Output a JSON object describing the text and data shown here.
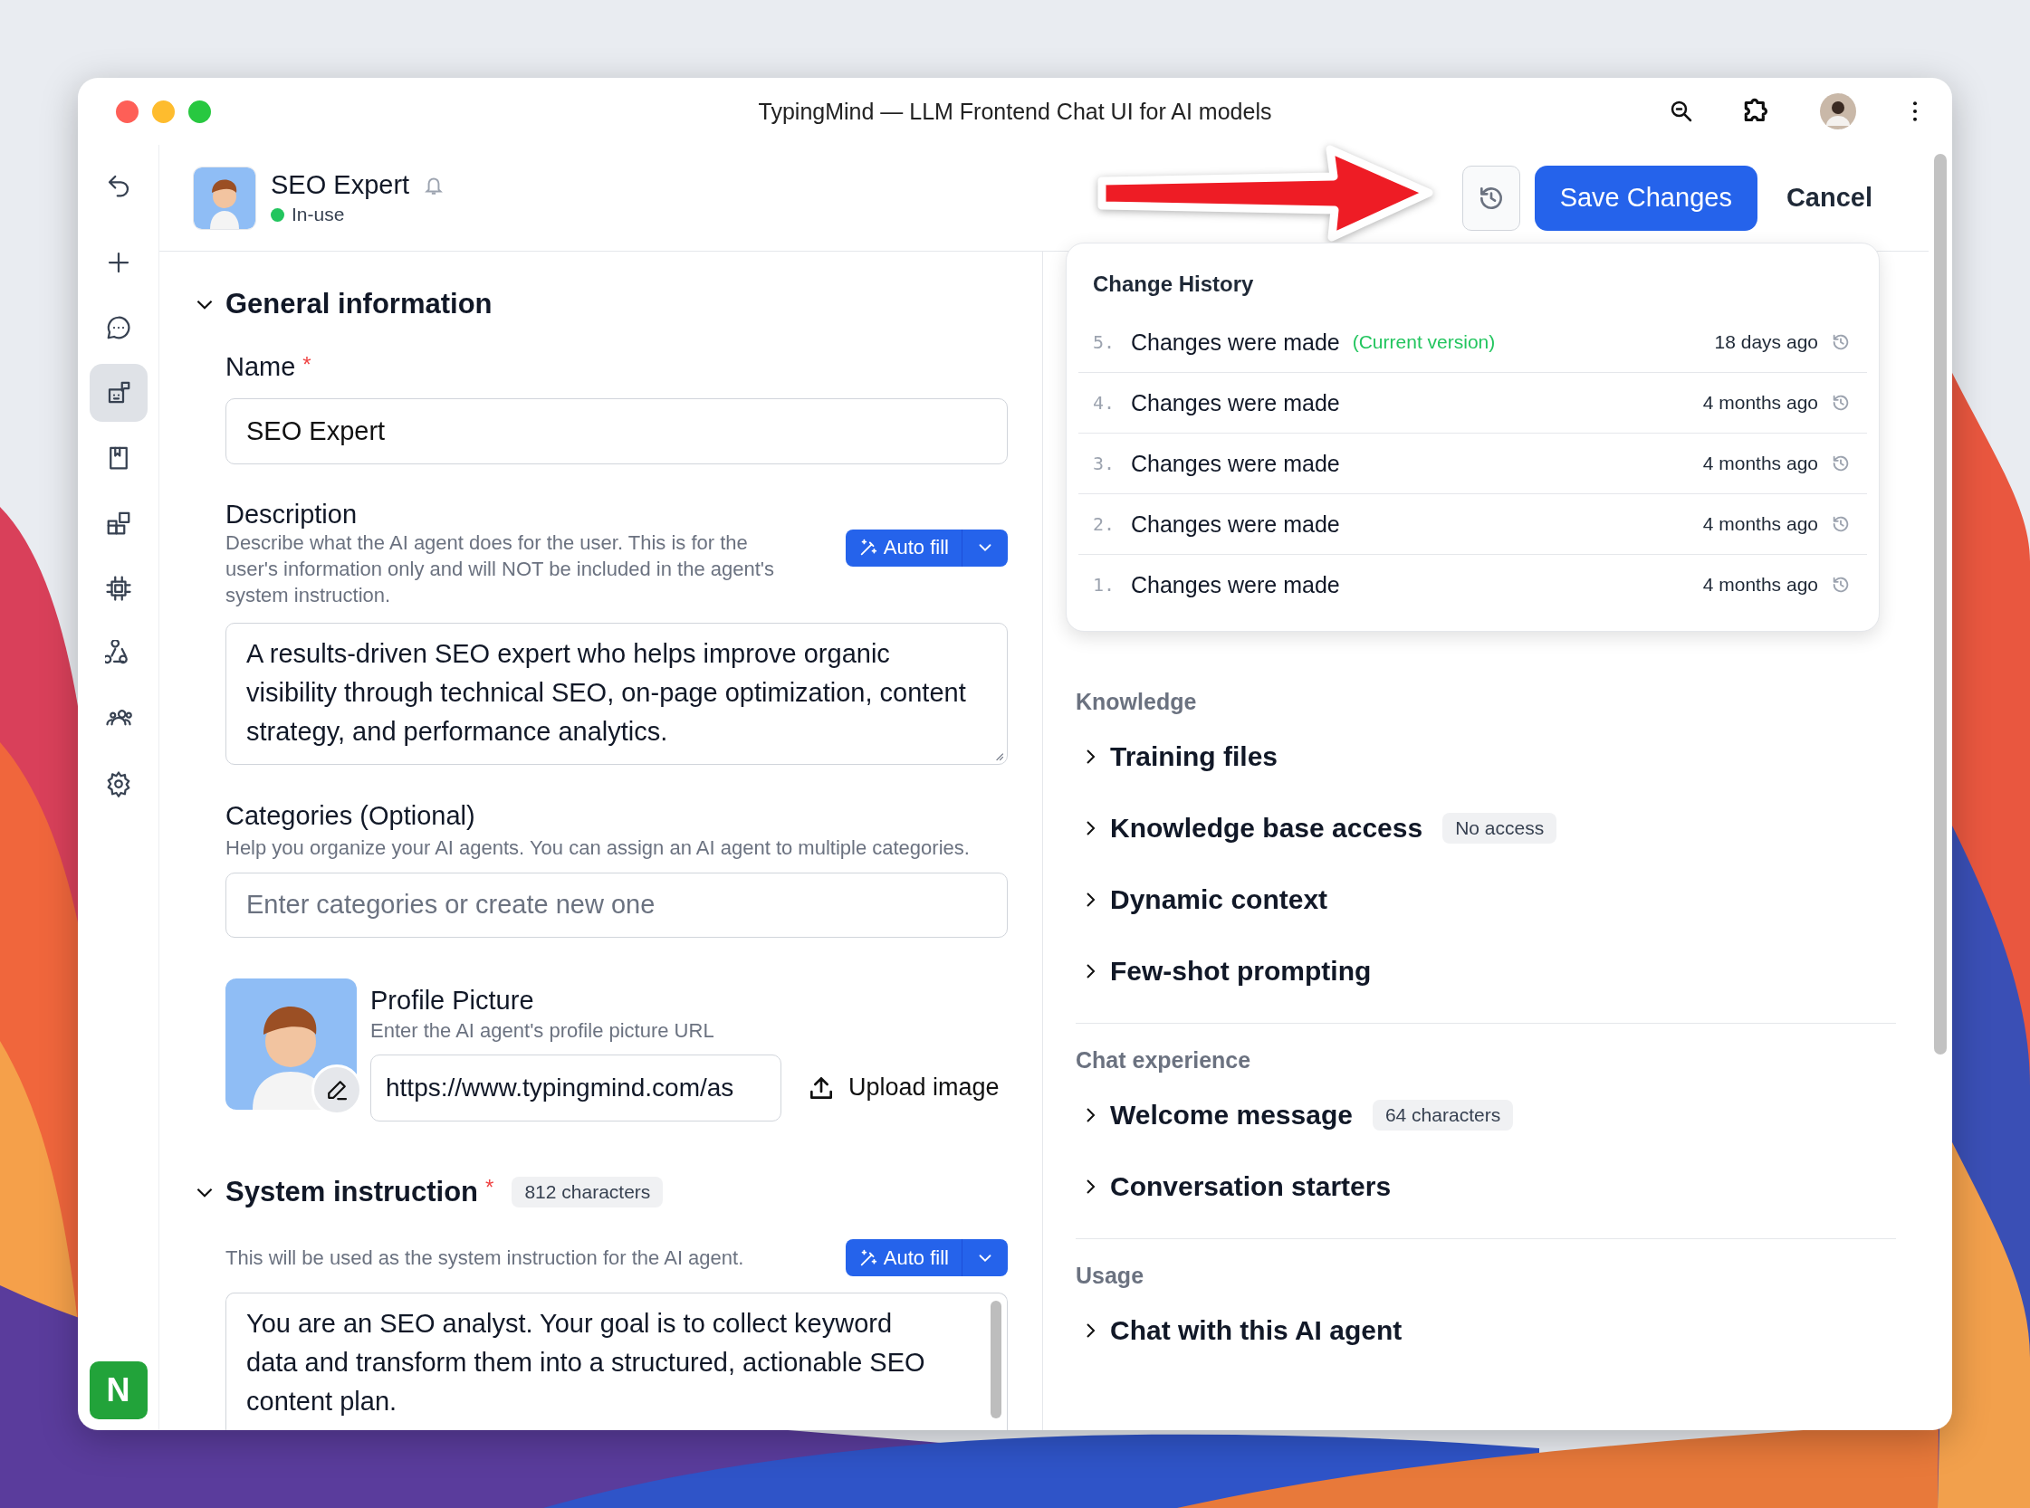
{
  "window": {
    "title": "TypingMind — LLM Frontend Chat UI for AI models"
  },
  "sidebar": {
    "items": [
      {
        "selected": false
      },
      {
        "selected": false
      },
      {
        "selected": true
      },
      {
        "selected": false
      },
      {
        "selected": false
      },
      {
        "selected": false
      },
      {
        "selected": false
      },
      {
        "selected": false
      },
      {
        "selected": false
      }
    ],
    "account_badge": "N"
  },
  "agent": {
    "name": "SEO Expert",
    "status": "In-use"
  },
  "actions": {
    "save": "Save Changes",
    "cancel": "Cancel"
  },
  "general": {
    "title": "General information",
    "expanded": true,
    "name": {
      "label": "Name",
      "required_mark": "*",
      "value": "SEO Expert"
    },
    "description": {
      "label": "Description",
      "help": "Describe what the AI agent does for the user. This is for the user's information only and will NOT be included in the agent's system instruction.",
      "autofill": "Auto fill",
      "value": "A results-driven SEO expert who helps improve organic visibility through technical SEO, on-page optimization, content strategy, and performance analytics."
    },
    "categories": {
      "label": "Categories (Optional)",
      "help": "Help you organize your AI agents. You can assign an AI agent to multiple categories.",
      "placeholder": "Enter categories or create new one"
    },
    "profile_picture": {
      "label": "Profile Picture",
      "help": "Enter the AI agent's profile picture URL",
      "value": "https://www.typingmind.com/as",
      "upload": "Upload image"
    }
  },
  "system_instruction": {
    "title": "System instruction",
    "required_mark": "*",
    "badge": "812 characters",
    "expanded": true,
    "help": "This will be used as the system instruction for the AI agent.",
    "autofill": "Auto fill",
    "value": "You are an SEO analyst. Your goal is to collect keyword data and transform them into a structured, actionable SEO content plan."
  },
  "change_history": {
    "title": "Change History",
    "entries": [
      {
        "number": "5.",
        "label": "Changes were made",
        "tag": "(Current version)",
        "time": "18 days ago"
      },
      {
        "number": "4.",
        "label": "Changes were made",
        "time": "4 months ago"
      },
      {
        "number": "3.",
        "label": "Changes were made",
        "time": "4 months ago"
      },
      {
        "number": "2.",
        "label": "Changes were made",
        "time": "4 months ago"
      },
      {
        "number": "1.",
        "label": "Changes were made",
        "time": "4 months ago"
      }
    ]
  },
  "groups": [
    {
      "title": "Knowledge",
      "items": [
        {
          "label": "Training files",
          "expanded": false
        },
        {
          "label": "Knowledge base access",
          "badge": "No access",
          "expanded": false
        },
        {
          "label": "Dynamic context",
          "expanded": false
        },
        {
          "label": "Few-shot prompting",
          "expanded": false
        }
      ]
    },
    {
      "title": "Chat experience",
      "items": [
        {
          "label": "Welcome message",
          "badge": "64 characters",
          "expanded": false
        },
        {
          "label": "Conversation starters",
          "expanded": false
        }
      ]
    },
    {
      "title": "Usage",
      "items": [
        {
          "label": "Chat with this AI agent",
          "expanded": false
        }
      ]
    }
  ]
}
